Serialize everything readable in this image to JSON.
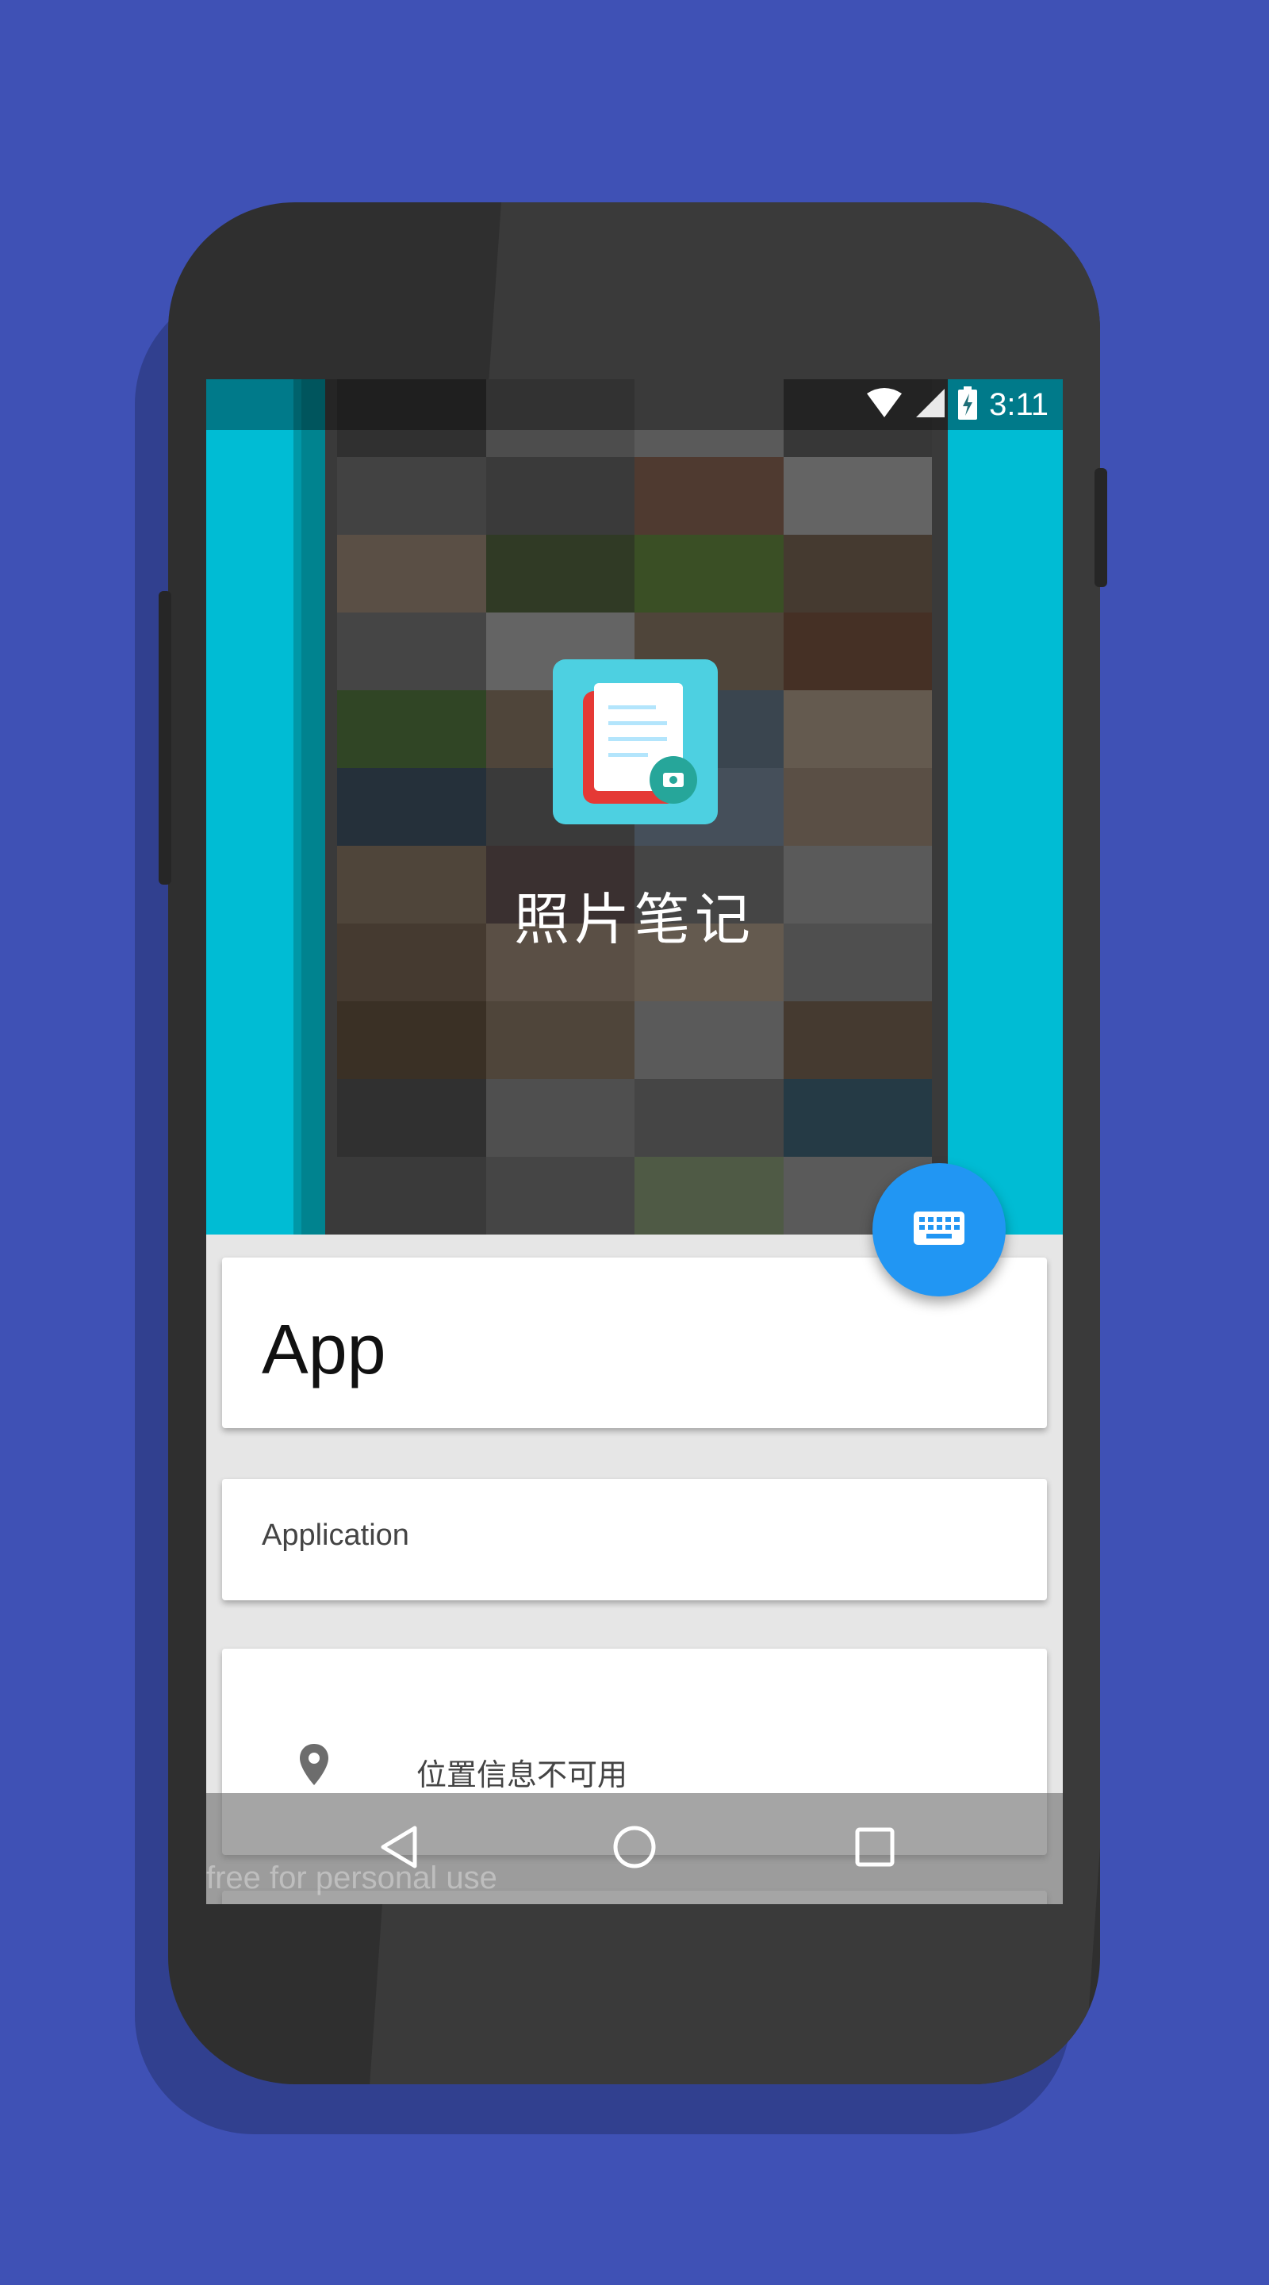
{
  "status_bar": {
    "time": "3:11"
  },
  "header": {
    "app_name": "照片笔记"
  },
  "note": {
    "title": "App",
    "subtitle": "Application",
    "location": "位置信息不可用"
  },
  "watermark": "free for personal use",
  "colors": {
    "background": "#3f51b5",
    "header": "#00bcd4",
    "fab": "#2196f3",
    "card": "#ffffff"
  },
  "icons": {
    "fab": "keyboard-icon",
    "location": "location-pin-icon",
    "nav_back": "back-triangle-icon",
    "nav_home": "home-circle-icon",
    "nav_recents": "recents-square-icon"
  }
}
